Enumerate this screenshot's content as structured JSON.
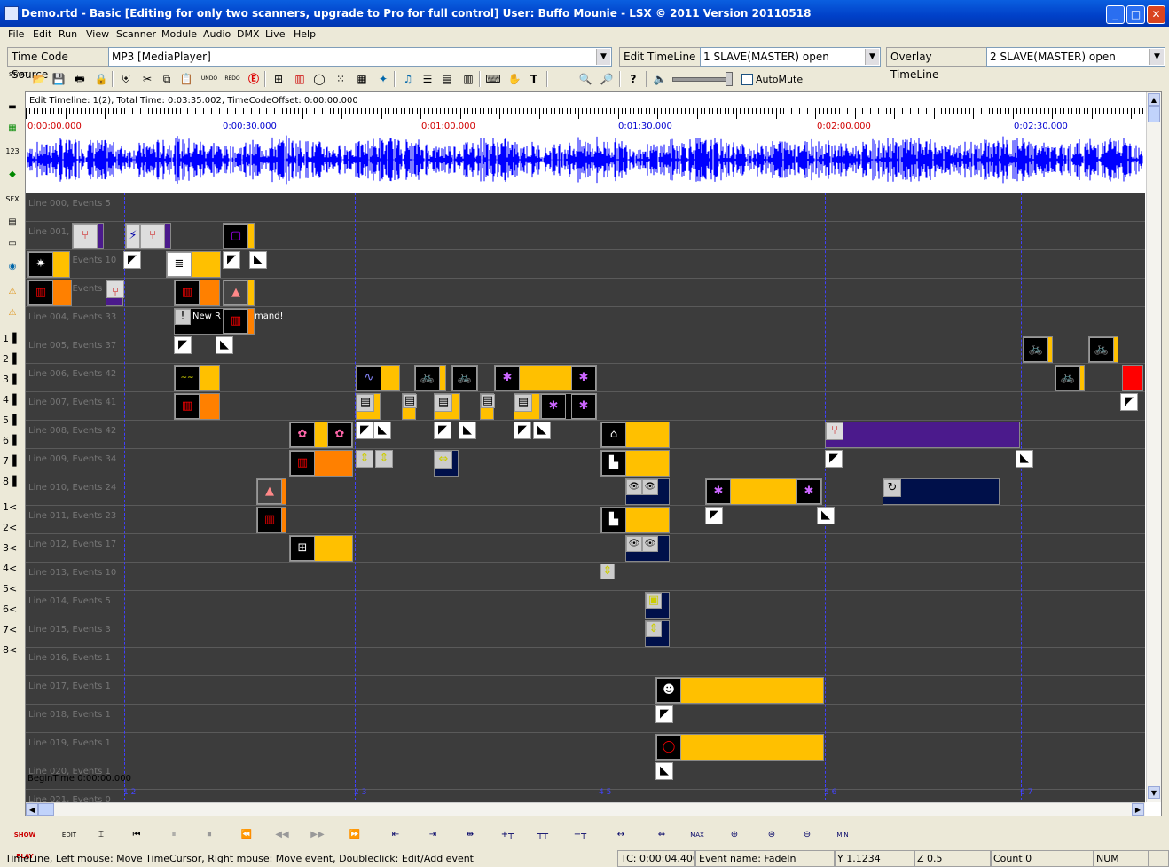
{
  "window": {
    "title": "Demo.rtd - Basic [Editing for only two scanners, upgrade to Pro for full control] User: Buffo Mounie - LSX © 2011  Version 20110518",
    "minimize": "_",
    "maximize": "□",
    "close": "✕"
  },
  "menu": [
    "File",
    "Edit",
    "Run",
    "View",
    "Scanner",
    "Module",
    "Audio",
    "DMX",
    "Live",
    "Help"
  ],
  "combos": {
    "tc_label": "Time Code Source",
    "tc_value": "MP3 [MediaPlayer]",
    "edit_label": "Edit TimeLine",
    "edit_value": "1 SLAVE(MASTER) open",
    "overlay_label": "Overlay TimeLine",
    "overlay_value": "2 SLAVE(MASTER) open",
    "arrow": "▼"
  },
  "toolbar": {
    "start_label": "START",
    "undo_label": "UNDO",
    "redo_label": "REDO",
    "automute_label": "AutoMute"
  },
  "timeline": {
    "info": "Edit Timeline: 1(2), Total Time: 0:03:35.002, TimeCodeOffset: 0:00:00.000",
    "time_labels": [
      "0:00:00.000",
      "0:00:30.000",
      "0:01:00.000",
      "0:01:30.000",
      "0:02:00.000",
      "0:02:30.000"
    ],
    "begin_time": "BeginTime 0:00:00.000",
    "markers": [
      "1 2",
      "2 3",
      "4 5",
      "5 6",
      "6 7"
    ],
    "lanes": [
      "Line 000, Events 5",
      "Line 001, E",
      "Line 002, Events 10",
      "Line 003, Events",
      "Line 004, Events 33",
      "Line 005, Events 37",
      "Line 006, Events 42",
      "Line 007, Events 41",
      "Line 008, Events 42",
      "Line 009, Events 34",
      "Line 010, Events 24",
      "Line 011, Events 23",
      "Line 012, Events 17",
      "Line 013, Events 10",
      "Line 014, Events 5",
      "Line 015, Events 3",
      "Line 016, Events 1",
      "Line 017, Events 1",
      "Line 018, Events 1",
      "Line 019, Events 1",
      "Line 020, Events 1",
      "Line 021, Events 0"
    ],
    "event_text_new": "New R",
    "event_text_mand": "mand!",
    "colors": {
      "orange": "#ff8000",
      "yellow": "#ffc000",
      "purple": "#4b1a8c",
      "navy": "#00104a",
      "lane": "#3c3c3c",
      "wave": "#0000ff"
    }
  },
  "left_numbers": [
    "1▐",
    "2▐",
    "3▐",
    "4▐",
    "5▐",
    "6▐",
    "7▐",
    "8▐",
    "1<",
    "2<",
    "3<",
    "4<",
    "5<",
    "6<",
    "7<",
    "8<"
  ],
  "bottom": {
    "show_play": "SHOW PLAY",
    "edit": "EDIT",
    "max": "MAX",
    "min": "MIN"
  },
  "status": {
    "hint": "TimeLine, Left mouse: Move TimeCursor, Right mouse: Move event, Doubleclick: Edit/Add event",
    "tc": "TC: 0:00:04.400",
    "event_name": "Event name: FadeIn",
    "y": "Y 1.1234",
    "z": "Z 0.5",
    "count": "Count 0",
    "num": "NUM"
  }
}
